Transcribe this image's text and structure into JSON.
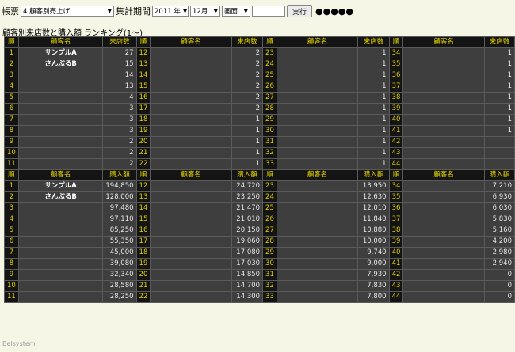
{
  "toolbar": {
    "report_label": "帳票",
    "report_select": "4 顧客別売上げ",
    "period_label": "集計期間",
    "year_select": "2011 年",
    "month_select": "12月",
    "output_select": "画面",
    "execute_button": "実行",
    "progress": "●●●●●"
  },
  "title": "顧客別来店数と購入額 ランキング(1〜)",
  "footer": "Belsystem",
  "visits_table": {
    "headers": {
      "rank": "順",
      "name": "顧客名",
      "value": "来店数"
    },
    "rows": [
      [
        {
          "rank": "1",
          "name": "サンプルA",
          "value": "27"
        },
        {
          "rank": "12",
          "name": "",
          "value": "2"
        },
        {
          "rank": "23",
          "name": "",
          "value": "1"
        },
        {
          "rank": "34",
          "name": "",
          "value": "1"
        }
      ],
      [
        {
          "rank": "2",
          "name": "さんぷるB",
          "value": "15"
        },
        {
          "rank": "13",
          "name": "",
          "value": "2"
        },
        {
          "rank": "24",
          "name": "",
          "value": "1"
        },
        {
          "rank": "35",
          "name": "",
          "value": "1"
        }
      ],
      [
        {
          "rank": "3",
          "name": "",
          "value": "14"
        },
        {
          "rank": "14",
          "name": "",
          "value": "2"
        },
        {
          "rank": "25",
          "name": "",
          "value": "1"
        },
        {
          "rank": "36",
          "name": "",
          "value": "1"
        }
      ],
      [
        {
          "rank": "4",
          "name": "",
          "value": "13"
        },
        {
          "rank": "15",
          "name": "",
          "value": "2"
        },
        {
          "rank": "26",
          "name": "",
          "value": "1"
        },
        {
          "rank": "37",
          "name": "",
          "value": "1"
        }
      ],
      [
        {
          "rank": "5",
          "name": "",
          "value": "4"
        },
        {
          "rank": "16",
          "name": "",
          "value": "2"
        },
        {
          "rank": "27",
          "name": "",
          "value": "1"
        },
        {
          "rank": "38",
          "name": "",
          "value": "1"
        }
      ],
      [
        {
          "rank": "6",
          "name": "",
          "value": "3"
        },
        {
          "rank": "17",
          "name": "",
          "value": "2"
        },
        {
          "rank": "28",
          "name": "",
          "value": "1"
        },
        {
          "rank": "39",
          "name": "",
          "value": "1"
        }
      ],
      [
        {
          "rank": "7",
          "name": "",
          "value": "3"
        },
        {
          "rank": "18",
          "name": "",
          "value": "1"
        },
        {
          "rank": "29",
          "name": "",
          "value": "1"
        },
        {
          "rank": "40",
          "name": "",
          "value": "1"
        }
      ],
      [
        {
          "rank": "8",
          "name": "",
          "value": "3"
        },
        {
          "rank": "19",
          "name": "",
          "value": "1"
        },
        {
          "rank": "30",
          "name": "",
          "value": "1"
        },
        {
          "rank": "41",
          "name": "",
          "value": "1"
        }
      ],
      [
        {
          "rank": "9",
          "name": "",
          "value": "2"
        },
        {
          "rank": "20",
          "name": "",
          "value": "1"
        },
        {
          "rank": "31",
          "name": "",
          "value": "1"
        },
        {
          "rank": "42",
          "name": "",
          "value": ""
        }
      ],
      [
        {
          "rank": "10",
          "name": "",
          "value": "2"
        },
        {
          "rank": "21",
          "name": "",
          "value": "1"
        },
        {
          "rank": "32",
          "name": "",
          "value": "1"
        },
        {
          "rank": "43",
          "name": "",
          "value": ""
        }
      ],
      [
        {
          "rank": "11",
          "name": "",
          "value": "2"
        },
        {
          "rank": "22",
          "name": "",
          "value": "1"
        },
        {
          "rank": "33",
          "name": "",
          "value": "1"
        },
        {
          "rank": "44",
          "name": "",
          "value": ""
        }
      ]
    ]
  },
  "purchase_table": {
    "headers": {
      "rank": "順",
      "name": "顧客名",
      "value": "購入額"
    },
    "rows": [
      [
        {
          "rank": "1",
          "name": "サンプルA",
          "value": "194,850"
        },
        {
          "rank": "12",
          "name": "",
          "value": "24,720"
        },
        {
          "rank": "23",
          "name": "",
          "value": "13,950"
        },
        {
          "rank": "34",
          "name": "",
          "value": "7,210"
        }
      ],
      [
        {
          "rank": "2",
          "name": "さんぷるB",
          "value": "128,000"
        },
        {
          "rank": "13",
          "name": "",
          "value": "23,250"
        },
        {
          "rank": "24",
          "name": "",
          "value": "12,630"
        },
        {
          "rank": "35",
          "name": "",
          "value": "6,930"
        }
      ],
      [
        {
          "rank": "3",
          "name": "",
          "value": "97,480"
        },
        {
          "rank": "14",
          "name": "",
          "value": "21,470"
        },
        {
          "rank": "25",
          "name": "",
          "value": "12,010"
        },
        {
          "rank": "36",
          "name": "",
          "value": "6,030"
        }
      ],
      [
        {
          "rank": "4",
          "name": "",
          "value": "97,110"
        },
        {
          "rank": "15",
          "name": "",
          "value": "21,010"
        },
        {
          "rank": "26",
          "name": "",
          "value": "11,840"
        },
        {
          "rank": "37",
          "name": "",
          "value": "5,830"
        }
      ],
      [
        {
          "rank": "5",
          "name": "",
          "value": "85,250"
        },
        {
          "rank": "16",
          "name": "",
          "value": "20,150"
        },
        {
          "rank": "27",
          "name": "",
          "value": "10,880"
        },
        {
          "rank": "38",
          "name": "",
          "value": "5,160"
        }
      ],
      [
        {
          "rank": "6",
          "name": "",
          "value": "55,350"
        },
        {
          "rank": "17",
          "name": "",
          "value": "19,060"
        },
        {
          "rank": "28",
          "name": "",
          "value": "10,000"
        },
        {
          "rank": "39",
          "name": "",
          "value": "4,200"
        }
      ],
      [
        {
          "rank": "7",
          "name": "",
          "value": "45,000"
        },
        {
          "rank": "18",
          "name": "",
          "value": "17,080"
        },
        {
          "rank": "29",
          "name": "",
          "value": "9,740"
        },
        {
          "rank": "40",
          "name": "",
          "value": "2,980"
        }
      ],
      [
        {
          "rank": "8",
          "name": "",
          "value": "39,080"
        },
        {
          "rank": "19",
          "name": "",
          "value": "17,030"
        },
        {
          "rank": "30",
          "name": "",
          "value": "9,000"
        },
        {
          "rank": "41",
          "name": "",
          "value": "2,940"
        }
      ],
      [
        {
          "rank": "9",
          "name": "",
          "value": "32,340"
        },
        {
          "rank": "20",
          "name": "",
          "value": "14,850"
        },
        {
          "rank": "31",
          "name": "",
          "value": "7,930"
        },
        {
          "rank": "42",
          "name": "",
          "value": "0"
        }
      ],
      [
        {
          "rank": "10",
          "name": "",
          "value": "28,580"
        },
        {
          "rank": "21",
          "name": "",
          "value": "14,700"
        },
        {
          "rank": "32",
          "name": "",
          "value": "7,830"
        },
        {
          "rank": "43",
          "name": "",
          "value": "0"
        }
      ],
      [
        {
          "rank": "11",
          "name": "",
          "value": "28,250"
        },
        {
          "rank": "22",
          "name": "",
          "value": "14,300"
        },
        {
          "rank": "33",
          "name": "",
          "value": "7,800"
        },
        {
          "rank": "44",
          "name": "",
          "value": "0"
        }
      ]
    ]
  }
}
